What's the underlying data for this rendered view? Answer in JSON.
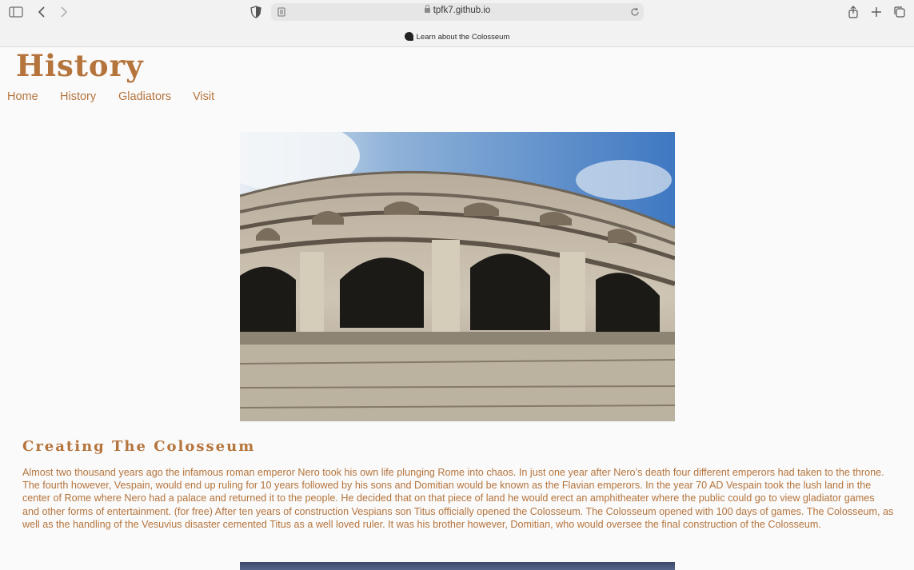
{
  "browser": {
    "url": "tpfk7.github.io",
    "tab_title": "Learn about the Colosseum"
  },
  "page": {
    "title": "History",
    "nav": [
      {
        "label": "Home"
      },
      {
        "label": "History"
      },
      {
        "label": "Gladiators"
      },
      {
        "label": "Visit"
      }
    ],
    "section": {
      "heading": "Creating The Colosseum",
      "body": "Almost two thousand years ago the infamous roman emperor Nero took his own life plunging Rome into chaos. In just one year after Nero’s death four different emperors had taken to the throne. The fourth however, Vespain, would end up ruling for 10 years followed by his sons and Domitian would be known as the Flavian emperors. In the year 70 AD Vespain took the lush land in the center of Rome where Nero had a palace and returned it to the people. He decided that on that piece of land he would erect an amphitheater where the public could go to view gladiator games and other forms of entertainment. (for free) After ten years of construction Vespians son Titus officially opened the Colosseum. The Colosseum opened with 100 days of games. The Colosseum, as well as the handling of the Vesuvius disaster cemented Titus as a well loved ruler. It was his brother however, Domitian, who would oversee the final construction of the Colosseum."
    }
  },
  "colors": {
    "accent": "#b5743c",
    "background": "#fafafa"
  }
}
